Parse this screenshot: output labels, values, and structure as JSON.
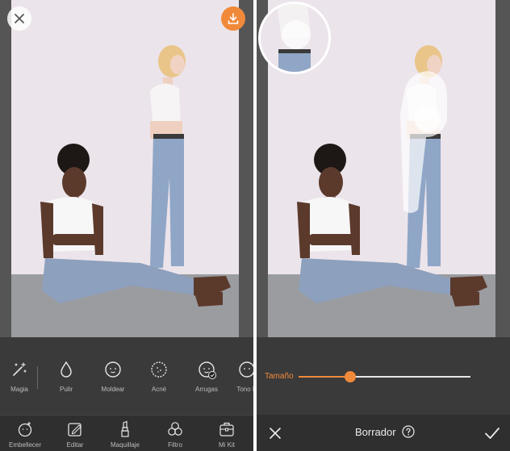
{
  "left": {
    "tools": [
      {
        "label": "Magia",
        "icon": "magic-wand-icon"
      },
      {
        "label": "Pulir",
        "icon": "droplet-icon"
      },
      {
        "label": "Moldear",
        "icon": "face-icon"
      },
      {
        "label": "Acné",
        "icon": "acne-face-icon"
      },
      {
        "label": "Arrugas",
        "icon": "wrinkle-face-icon"
      },
      {
        "label": "Tono D",
        "icon": "tone-face-icon"
      }
    ],
    "nav": [
      {
        "label": "Embellecer",
        "icon": "beautify-icon"
      },
      {
        "label": "Editar",
        "icon": "edit-icon"
      },
      {
        "label": "Maquillaje",
        "icon": "lipstick-icon"
      },
      {
        "label": "Filtro",
        "icon": "filter-icon"
      },
      {
        "label": "Mi Kit",
        "icon": "kit-icon"
      }
    ]
  },
  "right": {
    "slider_label": "Tamaño",
    "slider_value": 0.3,
    "title": "Borrador"
  },
  "colors": {
    "accent": "#f08a3a",
    "toolbar": "#3a3a3a",
    "navbar": "#2f2f2f",
    "label": "#bdbdbd"
  }
}
